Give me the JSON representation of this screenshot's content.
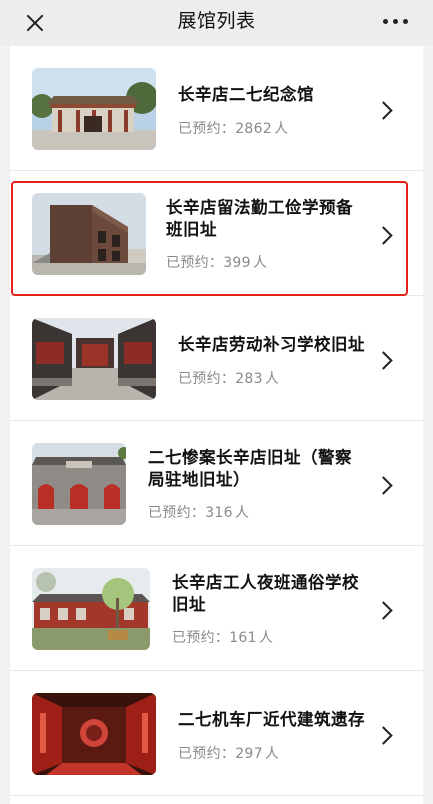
{
  "header": {
    "title": "展馆列表",
    "close_icon": "close-icon",
    "more_icon": "more-icon"
  },
  "booked_prefix": "已预约：",
  "count_suffix": "人",
  "highlight_color": "#e4231b",
  "venues": [
    {
      "name": "长辛店二七纪念馆",
      "count": "2862"
    },
    {
      "name": "长辛店留法勤工俭学预备班旧址",
      "count": "399"
    },
    {
      "name": "长辛店劳动补习学校旧址",
      "count": "283"
    },
    {
      "name": "二七惨案长辛店旧址（警察局驻地旧址）",
      "count": "316"
    },
    {
      "name": "长辛店工人夜班通俗学校旧址",
      "count": "161"
    },
    {
      "name": "二七机车厂近代建筑遗存",
      "count": "297"
    }
  ]
}
